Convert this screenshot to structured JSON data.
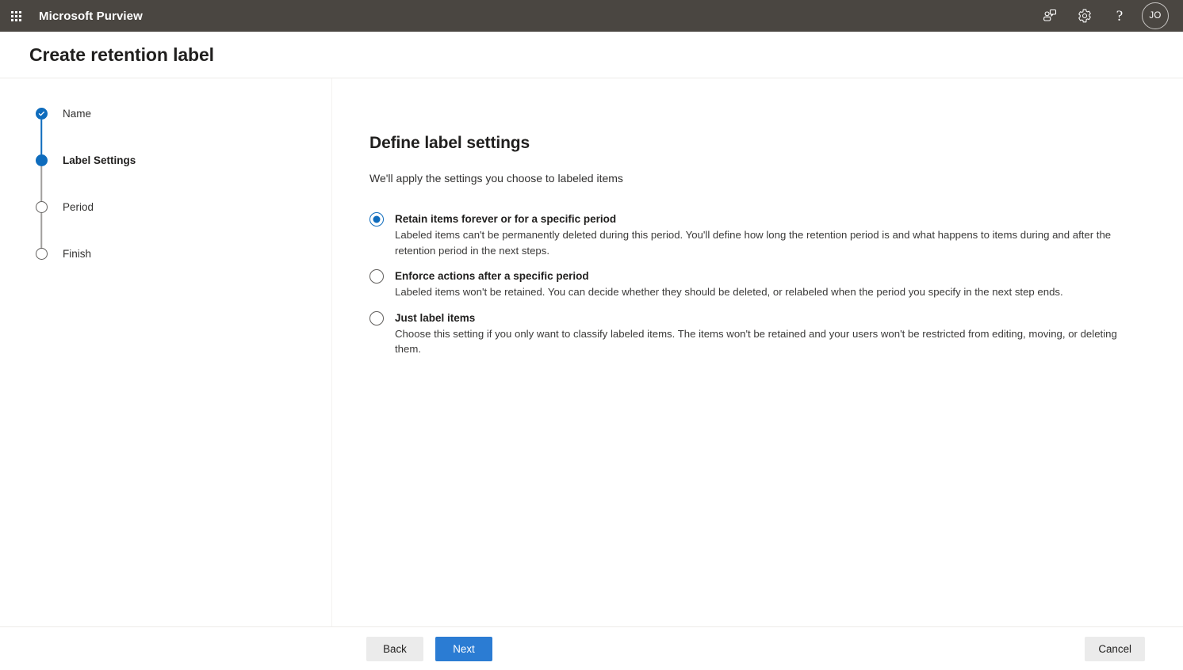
{
  "suitebar": {
    "app_launcher": "app-launcher",
    "brand": "Microsoft Purview",
    "actions": [
      {
        "name": "feedback-icon",
        "label": "Feedback"
      },
      {
        "name": "gear-icon",
        "label": "Settings"
      },
      {
        "name": "help-icon",
        "label": "?"
      }
    ],
    "avatar_initials": "JO"
  },
  "header": {
    "title": "Create retention label"
  },
  "wizard": {
    "steps": [
      {
        "label": "Name",
        "state": "done"
      },
      {
        "label": "Label Settings",
        "state": "current"
      },
      {
        "label": "Period",
        "state": "todo"
      },
      {
        "label": "Finish",
        "state": "todo"
      }
    ]
  },
  "main": {
    "title": "Define label settings",
    "subtitle": "We'll apply the settings you choose to labeled items",
    "options": [
      {
        "label": "Retain items forever or for a specific period",
        "description": "Labeled items can't be permanently deleted during this period. You'll define how long the retention period is and what happens to items during and after the retention period in the next steps.",
        "selected": true
      },
      {
        "label": "Enforce actions after a specific period",
        "description": "Labeled items won't be retained. You can decide whether they should be deleted, or relabeled when the period you specify in the next step ends.",
        "selected": false
      },
      {
        "label": "Just label items",
        "description": "Choose this setting if you only want to classify labeled items. The items won't be retained and your users won't be restricted from editing, moving, or deleting them.",
        "selected": false
      }
    ]
  },
  "footer": {
    "back_label": "Back",
    "next_label": "Next",
    "cancel_label": "Cancel"
  },
  "colors": {
    "suitebar_bg": "#4a4641",
    "accent_blue": "#0f6cbd",
    "primary_button": "#2b7cd3"
  }
}
